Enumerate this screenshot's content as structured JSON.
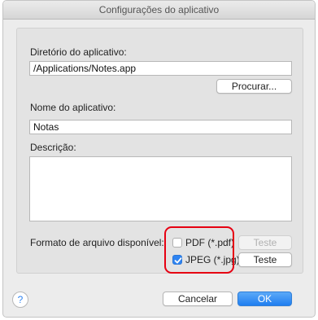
{
  "window": {
    "title": "Configurações do aplicativo"
  },
  "app_dir": {
    "label": "Diretório do aplicativo:",
    "value": "/Applications/Notes.app",
    "browse_label": "Procurar..."
  },
  "app_name": {
    "label": "Nome do aplicativo:",
    "value": "Notas"
  },
  "description": {
    "label": "Descrição:",
    "value": ""
  },
  "formats": {
    "label": "Formato de arquivo disponível:",
    "items": [
      {
        "label": "PDF (*.pdf)",
        "checked": false,
        "test_label": "Teste",
        "test_enabled": false
      },
      {
        "label": "JPEG (*.jpg)",
        "checked": true,
        "test_label": "Teste",
        "test_enabled": true
      }
    ]
  },
  "footer": {
    "help_symbol": "?",
    "cancel_label": "Cancelar",
    "ok_label": "OK"
  },
  "colors": {
    "accent": "#2f84f1",
    "highlight": "#e60012"
  }
}
